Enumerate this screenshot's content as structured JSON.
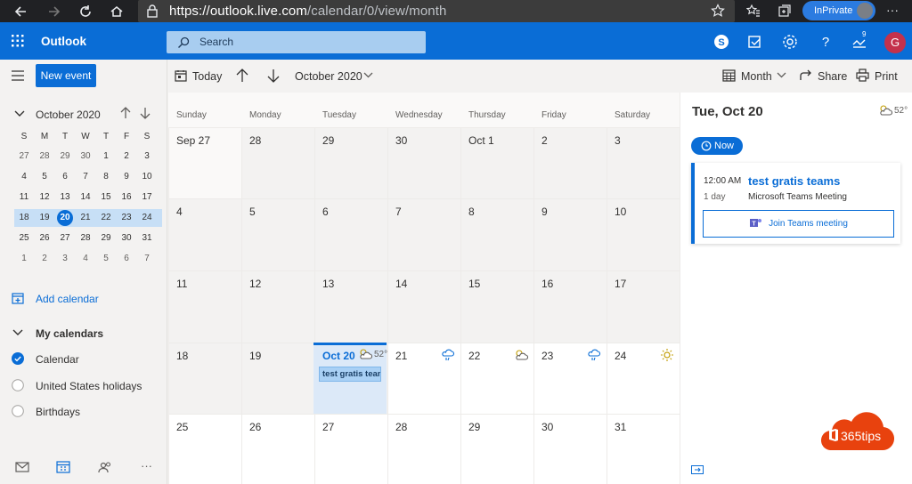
{
  "browser": {
    "url_main": "https://outlook.live.com",
    "url_path": "/calendar/0/view/month",
    "inprivate_label": "InPrivate",
    "more": "···"
  },
  "app": {
    "name": "Outlook",
    "search_placeholder": "Search",
    "avatar_initial": "G",
    "notif_count": "9",
    "accent": "#0a6dd6"
  },
  "left": {
    "new_event_label": "New event",
    "mini_month_title": "October 2020",
    "weekday_heads": [
      "S",
      "M",
      "T",
      "W",
      "T",
      "F",
      "S"
    ],
    "weeks": [
      [
        "27",
        "28",
        "29",
        "30",
        "1",
        "2",
        "3"
      ],
      [
        "4",
        "5",
        "6",
        "7",
        "8",
        "9",
        "10"
      ],
      [
        "11",
        "12",
        "13",
        "14",
        "15",
        "16",
        "17"
      ],
      [
        "18",
        "19",
        "20",
        "21",
        "22",
        "23",
        "24"
      ],
      [
        "25",
        "26",
        "27",
        "28",
        "29",
        "30",
        "31"
      ],
      [
        "1",
        "2",
        "3",
        "4",
        "5",
        "6",
        "7"
      ]
    ],
    "add_calendar_label": "Add calendar",
    "my_calendars_label": "My calendars",
    "calendars": [
      {
        "name": "Calendar",
        "checked": true
      },
      {
        "name": "United States holidays",
        "checked": false
      },
      {
        "name": "Birthdays",
        "checked": false
      }
    ]
  },
  "toolbar": {
    "today_label": "Today",
    "month_label": "October 2020",
    "view_label": "Month",
    "share_label": "Share",
    "print_label": "Print"
  },
  "grid": {
    "weekdays": [
      "Sunday",
      "Monday",
      "Tuesday",
      "Wednesday",
      "Thursday",
      "Friday",
      "Saturday"
    ],
    "weeks": [
      [
        "Sep 27",
        "28",
        "29",
        "30",
        "Oct 1",
        "2",
        "3"
      ],
      [
        "4",
        "5",
        "6",
        "7",
        "8",
        "9",
        "10"
      ],
      [
        "11",
        "12",
        "13",
        "14",
        "15",
        "16",
        "17"
      ],
      [
        "18",
        "19",
        "Oct 20",
        "21",
        "22",
        "23",
        "24"
      ],
      [
        "25",
        "26",
        "27",
        "28",
        "29",
        "30",
        "31"
      ]
    ],
    "today_temp": "52°",
    "event_chip": "test gratis teams"
  },
  "right": {
    "date_title": "Tue, Oct 20",
    "temp": "52°",
    "now_label": "Now",
    "event": {
      "time": "12:00 AM",
      "duration": "1 day",
      "title": "test gratis teams",
      "subtitle": "Microsoft Teams Meeting",
      "join_label": "Join Teams meeting"
    }
  },
  "badge": {
    "text": "365tips"
  }
}
